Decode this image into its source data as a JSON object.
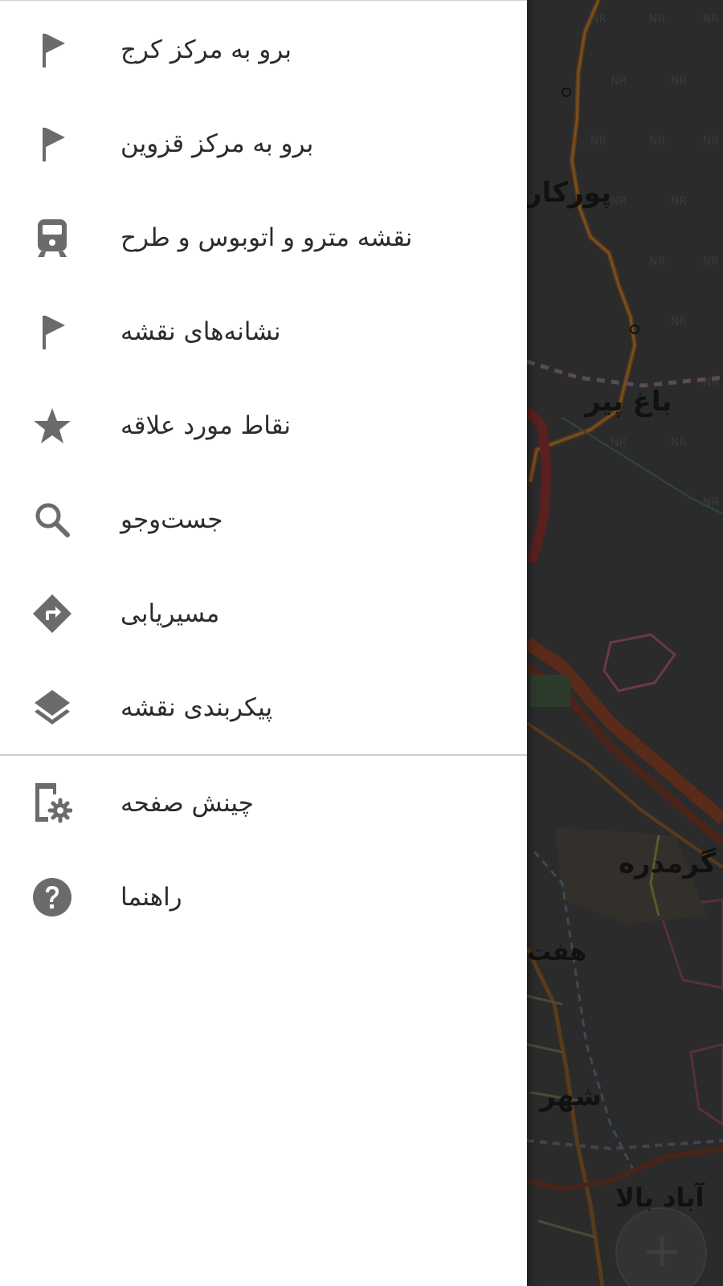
{
  "drawer": {
    "primary_items": [
      {
        "label": "برو به مرکز کرج",
        "icon": "flag-icon"
      },
      {
        "label": "برو به مرکز قزوین",
        "icon": "flag-icon"
      },
      {
        "label": "نقشه مترو و اتوبوس و طرح",
        "icon": "train-icon"
      },
      {
        "label": "نشانه‌های نقشه",
        "icon": "flag-icon"
      },
      {
        "label": "نقاط مورد علاقه",
        "icon": "star-icon"
      },
      {
        "label": "جست‌وجو",
        "icon": "search-icon"
      },
      {
        "label": "مسیریابی",
        "icon": "directions-icon"
      },
      {
        "label": "پیکربندی نقشه",
        "icon": "layers-icon"
      }
    ],
    "secondary_items": [
      {
        "label": "چینش صفحه",
        "icon": "device-settings-icon"
      },
      {
        "label": "راهنما",
        "icon": "help-icon"
      }
    ]
  },
  "map": {
    "labels": {
      "porkar": "پورکار",
      "bagh_pir": "باغ پیر",
      "garmdareh": "گرمدره",
      "haft": "هفت",
      "shahr": "شهر",
      "abad_bala": "آباد بالا"
    },
    "tile_tag": "NR",
    "zoom_in_symbol": "+"
  },
  "colors": {
    "icon_gray": "#6b6b6b",
    "text": "#2b2b2b",
    "divider": "#cfcfcf",
    "drawer_bg": "#ffffff"
  }
}
